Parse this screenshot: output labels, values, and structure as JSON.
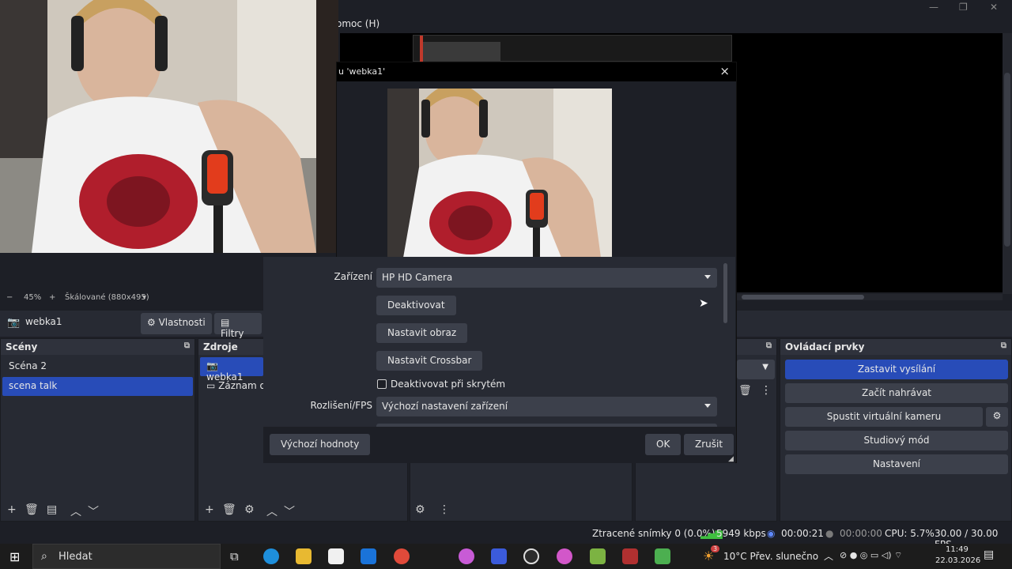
{
  "window": {
    "minimize_icon": "minimize-icon",
    "maximize_icon": "restore-icon",
    "close_icon": "close-icon"
  },
  "menu": {
    "help_label": "omoc (H)"
  },
  "zoom": {
    "minus": "−",
    "value": "45%",
    "plus": "+",
    "scale_label": "Škálované (880x495)"
  },
  "source_toolbar": {
    "source_name": "webka1",
    "properties_label": "Vlastnosti",
    "filters_label": "Filtry"
  },
  "scenes": {
    "title": "Scény",
    "items": [
      {
        "label": "Scéna 2",
        "selected": false
      },
      {
        "label": "scena talk",
        "selected": true
      }
    ]
  },
  "sources": {
    "title": "Zdroje",
    "items": [
      {
        "label": "webka1",
        "selected": true
      },
      {
        "label": "Záznam ob",
        "selected": false
      }
    ]
  },
  "controls": {
    "title": "Ovládací prvky",
    "stop_stream": "Zastavit vysílání",
    "start_record": "Začít nahrávat",
    "start_virtual_cam": "Spustit virtuální kameru",
    "studio_mode": "Studiový mód",
    "settings": "Nastavení"
  },
  "dialog": {
    "title": "u 'webka1'",
    "device_label": "Zařízení",
    "device_value": "HP HD Camera",
    "deactivate": "Deaktivovat",
    "configure_video": "Nastavit obraz",
    "configure_crossbar": "Nastavit Crossbar",
    "deactivate_hidden": "Deaktivovat při skrytém",
    "resolution_label": "Rozlišení/FPS",
    "resolution_value": "Výchozí nastavení zařízení",
    "defaults": "Výchozí hodnoty",
    "ok": "OK",
    "cancel": "Zrušit"
  },
  "status": {
    "dropped": "Ztracené snímky 0 (0.0%)",
    "bitrate": "5949 kbps",
    "stream_time": "00:00:21",
    "rec_time": "00:00:00",
    "cpu": "CPU: 5.7%",
    "fps": "30.00 / 30.00 FPS"
  },
  "taskbar": {
    "search_placeholder": "Hledat",
    "weather": "10°C  Přev. slunečno",
    "weather_badge": "3",
    "time": "11:49",
    "date": "22.03.2026"
  },
  "colors": {
    "accent": "#284cb8",
    "panel": "#272a33",
    "button": "#3c404b",
    "background": "#1d1f26"
  }
}
